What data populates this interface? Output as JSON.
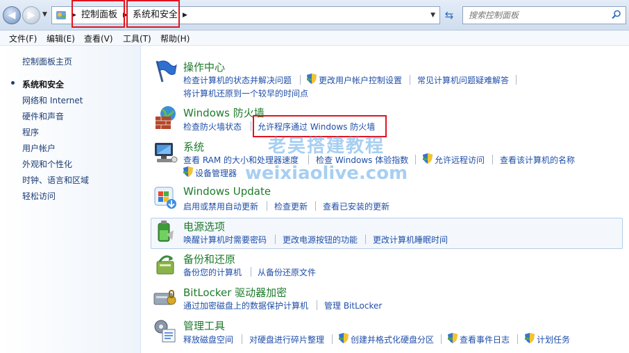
{
  "address": {
    "crumbs": [
      "控制面板",
      "系统和安全"
    ],
    "search_placeholder": "搜索控制面板"
  },
  "menu": [
    "文件(F)",
    "编辑(E)",
    "查看(V)",
    "工具(T)",
    "帮助(H)"
  ],
  "sidebar": {
    "home": "控制面板主页",
    "items": [
      "系统和安全",
      "网络和 Internet",
      "硬件和声音",
      "程序",
      "用户帐户",
      "外观和个性化",
      "时钟、语言和区域",
      "轻松访问"
    ]
  },
  "categories": {
    "action_center": {
      "title": "操作中心",
      "links": [
        "检查计算机的状态并解决问题",
        "更改用户帐户控制设置",
        "常见计算机问题疑难解答",
        "将计算机还原到一个较早的时间点"
      ]
    },
    "firewall": {
      "title": "Windows 防火墙",
      "links": [
        "检查防火墙状态",
        "允许程序通过 Windows 防火墙"
      ]
    },
    "system": {
      "title": "系统",
      "links": [
        "查看 RAM 的大小和处理器速度",
        "检查 Windows 体验指数",
        "允许远程访问",
        "查看该计算机的名称",
        "设备管理器"
      ]
    },
    "windows_update": {
      "title": "Windows Update",
      "links": [
        "启用或禁用自动更新",
        "检查更新",
        "查看已安装的更新"
      ]
    },
    "power": {
      "title": "电源选项",
      "links": [
        "唤醒计算机时需要密码",
        "更改电源按钮的功能",
        "更改计算机睡眠时间"
      ]
    },
    "backup": {
      "title": "备份和还原",
      "links": [
        "备份您的计算机",
        "从备份还原文件"
      ]
    },
    "bitlocker": {
      "title": "BitLocker 驱动器加密",
      "links": [
        "通过加密磁盘上的数据保护计算机",
        "管理 BitLocker"
      ]
    },
    "admin_tools": {
      "title": "管理工具",
      "links": [
        "释放磁盘空间",
        "对硬盘进行碎片整理",
        "创建并格式化硬盘分区",
        "查看事件日志",
        "计划任务"
      ]
    }
  },
  "watermark": {
    "line1": "老吴搭建教程",
    "line2": "weixiaolive.com"
  },
  "colors": {
    "category_title": "#1e7a2c",
    "link": "#1f4ea8",
    "highlight_red": "#e0141e"
  }
}
